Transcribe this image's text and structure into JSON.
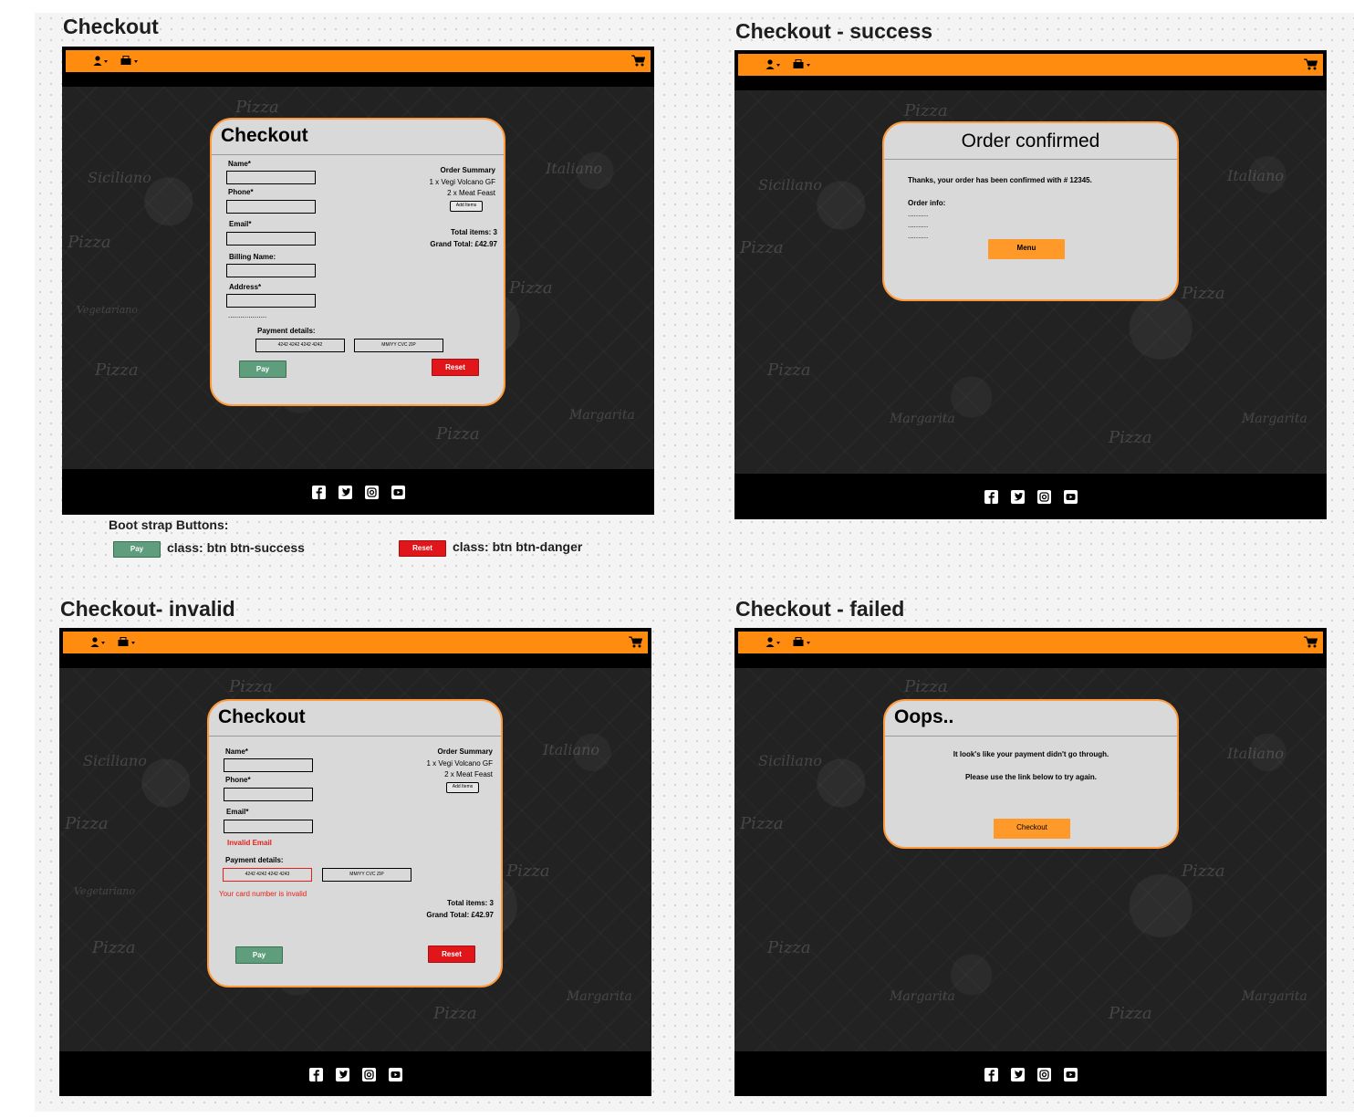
{
  "frames": {
    "checkout": {
      "title": "Checkout",
      "card_title": "Checkout",
      "name_label": "Name*",
      "phone_label": "Phone*",
      "email_label": "Email*",
      "billing_name_label": "Billing Name:",
      "address_label": "Address*",
      "dots": "...................",
      "payment_details_label": "Payment details:",
      "card_number": "4242 4242 4242 4242",
      "card_extra": "MM/YY CVC ZIP",
      "pay_label": "Pay",
      "reset_label": "Reset",
      "summary_title": "Order Summary",
      "summary_line1": "1 x Vegi Volcano GF",
      "summary_line2": "2 x Meat Feast",
      "add_items_label": "Add Items",
      "total_items": "Total items: 3",
      "grand_total": "Grand Total: £42.97"
    },
    "success": {
      "title": "Checkout - success",
      "card_title": "Order confirmed",
      "message": "Thanks, your order has been confirmed with # 12345.",
      "order_info_label": "Order info:",
      "info_lines": [
        "..........",
        "..........",
        ".........."
      ],
      "menu_label": "Menu"
    },
    "invalid": {
      "title": "Checkout- invalid",
      "card_title": "Checkout",
      "name_label": "Name*",
      "phone_label": "Phone*",
      "email_label": "Email*",
      "email_error": "Invalid Email",
      "payment_details_label": "Payment details:",
      "card_number": "4242 4242 4242 4243",
      "card_extra": "MM/YY CVC ZIP",
      "card_error": "Your card number is invalid",
      "pay_label": "Pay",
      "reset_label": "Reset",
      "summary_title": "Order Summary",
      "summary_line1": "1 x Vegi Volcano GF",
      "summary_line2": "2 x Meat Feast",
      "add_items_label": "Add Items",
      "total_items": "Total items: 3",
      "grand_total": "Grand Total: £42.97"
    },
    "failed": {
      "title": "Checkout - failed",
      "card_title": "Oops..",
      "line1": "It look's like your payment didn't go through.",
      "line2": "Please use the link below to try again.",
      "checkout_label": "Checkout"
    }
  },
  "legend": {
    "heading": "Boot strap Buttons:",
    "success_btn": "Pay",
    "success_class": "class: btn btn-success",
    "danger_btn": "Reset",
    "danger_class": "class: btn btn-danger"
  },
  "decor_words": [
    "Pizza",
    "Siciliano",
    "Italiano",
    "Margarita",
    "Vegetariano"
  ],
  "icons": {
    "nav": [
      "user-icon",
      "caret-down-icon",
      "pizza-box-icon",
      "cart-icon"
    ],
    "social": [
      "facebook-icon",
      "twitter-icon",
      "instagram-icon",
      "youtube-icon"
    ]
  },
  "colors": {
    "navbar": "#ff8c0e",
    "card_border": "#ff9a3c",
    "btn_success": "#5f9e7d",
    "btn_danger": "#e0161b",
    "error_text": "#e3221d",
    "orange_button": "#ff9a2a"
  }
}
